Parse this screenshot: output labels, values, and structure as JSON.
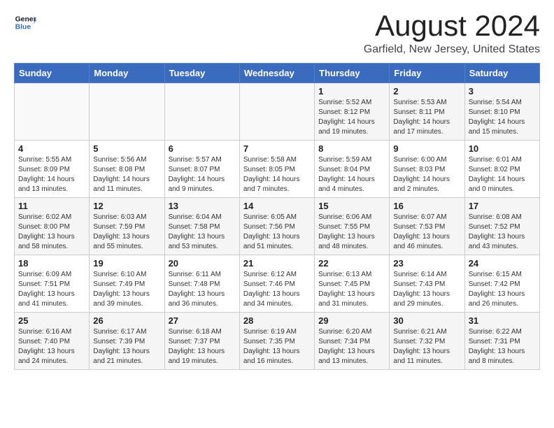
{
  "header": {
    "logo_line1": "General",
    "logo_line2": "Blue",
    "month": "August 2024",
    "location": "Garfield, New Jersey, United States"
  },
  "weekdays": [
    "Sunday",
    "Monday",
    "Tuesday",
    "Wednesday",
    "Thursday",
    "Friday",
    "Saturday"
  ],
  "weeks": [
    [
      {
        "day": "",
        "info": ""
      },
      {
        "day": "",
        "info": ""
      },
      {
        "day": "",
        "info": ""
      },
      {
        "day": "",
        "info": ""
      },
      {
        "day": "1",
        "info": "Sunrise: 5:52 AM\nSunset: 8:12 PM\nDaylight: 14 hours\nand 19 minutes."
      },
      {
        "day": "2",
        "info": "Sunrise: 5:53 AM\nSunset: 8:11 PM\nDaylight: 14 hours\nand 17 minutes."
      },
      {
        "day": "3",
        "info": "Sunrise: 5:54 AM\nSunset: 8:10 PM\nDaylight: 14 hours\nand 15 minutes."
      }
    ],
    [
      {
        "day": "4",
        "info": "Sunrise: 5:55 AM\nSunset: 8:09 PM\nDaylight: 14 hours\nand 13 minutes."
      },
      {
        "day": "5",
        "info": "Sunrise: 5:56 AM\nSunset: 8:08 PM\nDaylight: 14 hours\nand 11 minutes."
      },
      {
        "day": "6",
        "info": "Sunrise: 5:57 AM\nSunset: 8:07 PM\nDaylight: 14 hours\nand 9 minutes."
      },
      {
        "day": "7",
        "info": "Sunrise: 5:58 AM\nSunset: 8:05 PM\nDaylight: 14 hours\nand 7 minutes."
      },
      {
        "day": "8",
        "info": "Sunrise: 5:59 AM\nSunset: 8:04 PM\nDaylight: 14 hours\nand 4 minutes."
      },
      {
        "day": "9",
        "info": "Sunrise: 6:00 AM\nSunset: 8:03 PM\nDaylight: 14 hours\nand 2 minutes."
      },
      {
        "day": "10",
        "info": "Sunrise: 6:01 AM\nSunset: 8:02 PM\nDaylight: 14 hours\nand 0 minutes."
      }
    ],
    [
      {
        "day": "11",
        "info": "Sunrise: 6:02 AM\nSunset: 8:00 PM\nDaylight: 13 hours\nand 58 minutes."
      },
      {
        "day": "12",
        "info": "Sunrise: 6:03 AM\nSunset: 7:59 PM\nDaylight: 13 hours\nand 55 minutes."
      },
      {
        "day": "13",
        "info": "Sunrise: 6:04 AM\nSunset: 7:58 PM\nDaylight: 13 hours\nand 53 minutes."
      },
      {
        "day": "14",
        "info": "Sunrise: 6:05 AM\nSunset: 7:56 PM\nDaylight: 13 hours\nand 51 minutes."
      },
      {
        "day": "15",
        "info": "Sunrise: 6:06 AM\nSunset: 7:55 PM\nDaylight: 13 hours\nand 48 minutes."
      },
      {
        "day": "16",
        "info": "Sunrise: 6:07 AM\nSunset: 7:53 PM\nDaylight: 13 hours\nand 46 minutes."
      },
      {
        "day": "17",
        "info": "Sunrise: 6:08 AM\nSunset: 7:52 PM\nDaylight: 13 hours\nand 43 minutes."
      }
    ],
    [
      {
        "day": "18",
        "info": "Sunrise: 6:09 AM\nSunset: 7:51 PM\nDaylight: 13 hours\nand 41 minutes."
      },
      {
        "day": "19",
        "info": "Sunrise: 6:10 AM\nSunset: 7:49 PM\nDaylight: 13 hours\nand 39 minutes."
      },
      {
        "day": "20",
        "info": "Sunrise: 6:11 AM\nSunset: 7:48 PM\nDaylight: 13 hours\nand 36 minutes."
      },
      {
        "day": "21",
        "info": "Sunrise: 6:12 AM\nSunset: 7:46 PM\nDaylight: 13 hours\nand 34 minutes."
      },
      {
        "day": "22",
        "info": "Sunrise: 6:13 AM\nSunset: 7:45 PM\nDaylight: 13 hours\nand 31 minutes."
      },
      {
        "day": "23",
        "info": "Sunrise: 6:14 AM\nSunset: 7:43 PM\nDaylight: 13 hours\nand 29 minutes."
      },
      {
        "day": "24",
        "info": "Sunrise: 6:15 AM\nSunset: 7:42 PM\nDaylight: 13 hours\nand 26 minutes."
      }
    ],
    [
      {
        "day": "25",
        "info": "Sunrise: 6:16 AM\nSunset: 7:40 PM\nDaylight: 13 hours\nand 24 minutes."
      },
      {
        "day": "26",
        "info": "Sunrise: 6:17 AM\nSunset: 7:39 PM\nDaylight: 13 hours\nand 21 minutes."
      },
      {
        "day": "27",
        "info": "Sunrise: 6:18 AM\nSunset: 7:37 PM\nDaylight: 13 hours\nand 19 minutes."
      },
      {
        "day": "28",
        "info": "Sunrise: 6:19 AM\nSunset: 7:35 PM\nDaylight: 13 hours\nand 16 minutes."
      },
      {
        "day": "29",
        "info": "Sunrise: 6:20 AM\nSunset: 7:34 PM\nDaylight: 13 hours\nand 13 minutes."
      },
      {
        "day": "30",
        "info": "Sunrise: 6:21 AM\nSunset: 7:32 PM\nDaylight: 13 hours\nand 11 minutes."
      },
      {
        "day": "31",
        "info": "Sunrise: 6:22 AM\nSunset: 7:31 PM\nDaylight: 13 hours\nand 8 minutes."
      }
    ]
  ]
}
